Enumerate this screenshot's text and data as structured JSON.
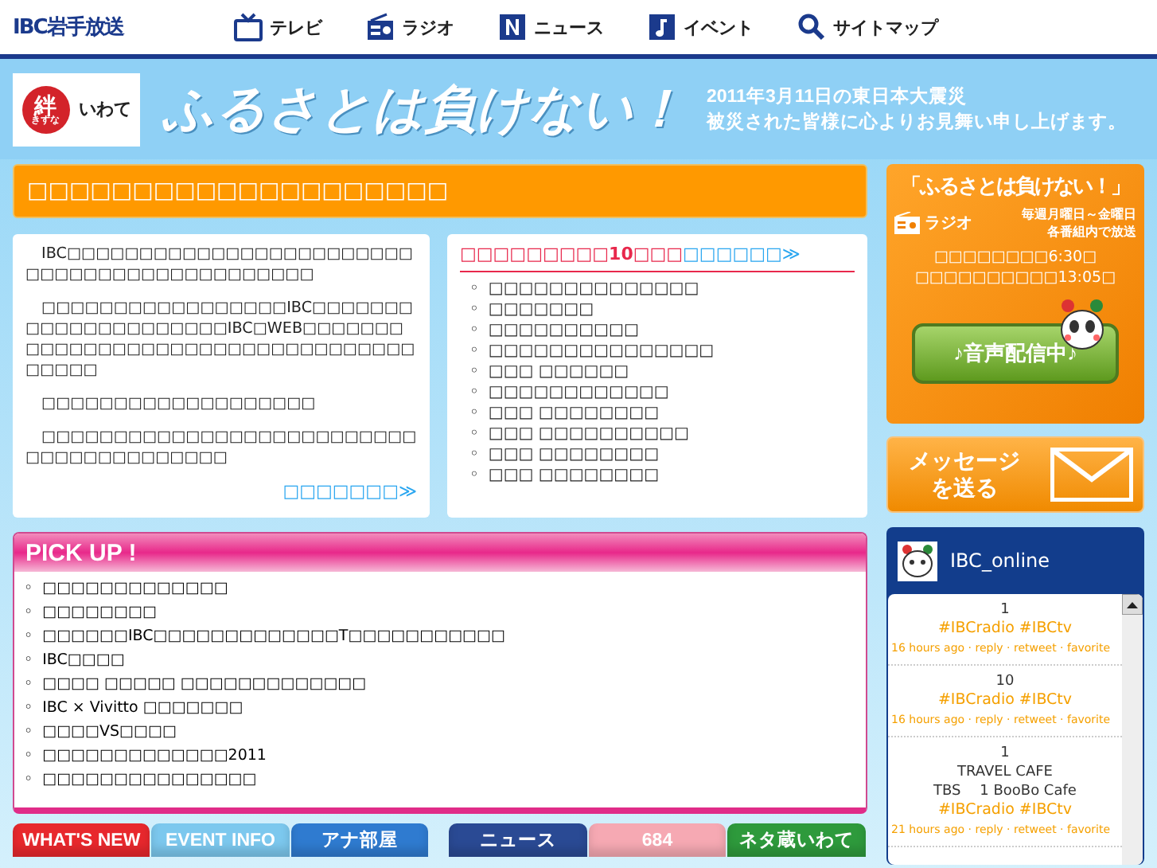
{
  "header": {
    "logo": "IBC岩手放送",
    "nav": [
      {
        "kind": "tv",
        "label": "テレビ"
      },
      {
        "kind": "radio",
        "label": "ラジオ"
      },
      {
        "kind": "news",
        "label": "ニュース"
      },
      {
        "kind": "event",
        "label": "イベント"
      },
      {
        "kind": "search",
        "label": "サイトマップ"
      }
    ]
  },
  "banner": {
    "badge_mark": "絆",
    "badge_reading": "きずな",
    "badge_label": "いわて",
    "slogan": "ふるさとは負けない！",
    "message": [
      "2011年3月11日の東日本大震災",
      "被災された皆様に心よりお見舞い申し上げます。"
    ]
  },
  "title_bar": "□□□□□□□□□□□□□□□□□□□□",
  "notice": {
    "paragraphs": [
      "IBC□□□□□□□□□□□□□□□□□□□□□□□□□□□□□□□□□□□□□□□□□□□□",
      "□□□□□□□□□□□□□□□□□IBC□□□□□□□□□□□□□□□□□□□□□IBC□WEB□□□□□□□□□□□□□□□□□□□□□□□□□□□□□□□□□□□□□□□",
      "□□□□□□□□□□□□□□□□□□□",
      "□□□□□□□□□□□□□□□□□□□□□□□□□□□□□□□□□□□□□□□□"
    ],
    "link": "□□□□□□□≫"
  },
  "ranking": {
    "bullet": "◦",
    "heading": "□□□□□□□□□10□□□",
    "link": "□□□□□□≫",
    "items": [
      "□□□□□□□□□□□□□□",
      "□□□□□□□",
      "□□□□□□□□□□",
      "□□□□□□□□□□□□□□□",
      "□□□ □□□□□□",
      "□□□□□□□□□□□□",
      "□□□ □□□□□□□□",
      "□□□ □□□□□□□□□□",
      "□□□ □□□□□□□□",
      "□□□ □□□□□□□□"
    ]
  },
  "pickup": {
    "bullet": "◦",
    "title": "PICK UP !",
    "items": [
      "□□□□□□□□□□□□□",
      "□□□□□□□□",
      "□□□□□□IBC□□□□□□□□□□□□□T□□□□□□□□□□□",
      "IBC□□□□",
      "□□□□ □□□□□ □□□□□□□□□□□□□",
      "IBC × Vivitto □□□□□□□",
      "□□□□VS□□□□",
      "□□□□□□□□□□□□□2011",
      "□□□□□□□□□□□□□□□"
    ]
  },
  "tabs_left": [
    {
      "label": "WHAT'S NEW",
      "color": "#e8282d"
    },
    {
      "label": "EVENT INFO",
      "color": "#7cc8ee"
    },
    {
      "label": "アナ部屋",
      "color": "#2f7bd0"
    }
  ],
  "tabs_right": [
    {
      "label": "ニュース",
      "color": "#2a4a94"
    },
    {
      "label": "684",
      "color": "#f6a9b3"
    },
    {
      "label": "ネタ蔵いわて",
      "color": "#2e9a3c"
    }
  ],
  "radio_box": {
    "title": "「ふるさとは負けない！」",
    "label": "ラジオ",
    "schedule": [
      "毎週月曜日～金曜日",
      "各番組内で放送"
    ],
    "times": [
      "□□□□□□□□6:30□",
      "□□□□□□□□□□13:05□"
    ],
    "button": "♪音声配信中♪"
  },
  "message_button": "メッセージを送る",
  "twitter": {
    "account": "IBC_online",
    "tweets": [
      {
        "lines": [
          "1"
        ],
        "tags": "#IBCradio #IBCtv",
        "meta": "16 hours ago · reply · retweet · favorite"
      },
      {
        "lines": [
          "10"
        ],
        "tags": "#IBCradio #IBCtv",
        "meta": "16 hours ago · reply · retweet · favorite"
      },
      {
        "lines": [
          "1",
          "TRAVEL CAFE",
          "TBS　 1  BooBo Cafe"
        ],
        "tags": "#IBCradio #IBCtv",
        "meta": "21 hours ago · reply · retweet · favorite"
      }
    ]
  }
}
